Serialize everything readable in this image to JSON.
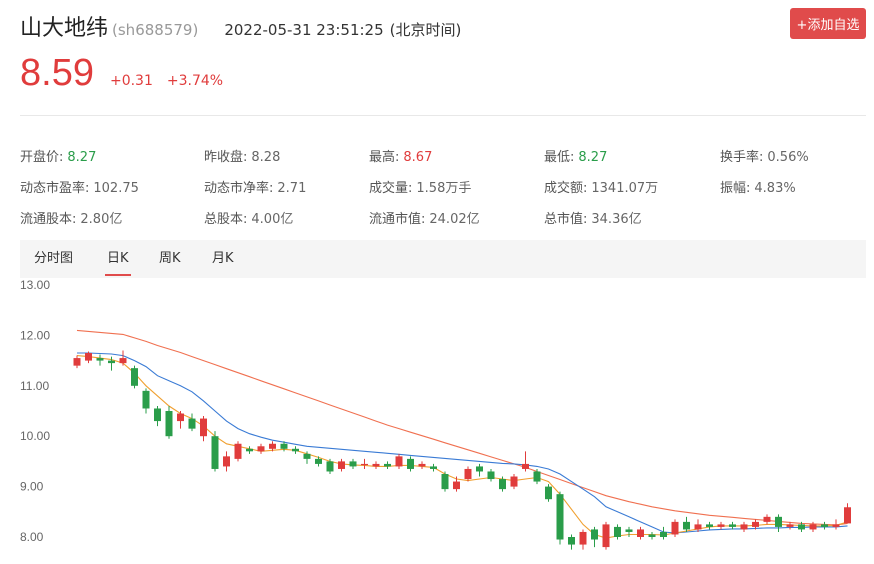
{
  "header": {
    "name": "山大地纬",
    "code": "(sh688579)",
    "datetime": "2022-05-31 23:51:25",
    "tz": "(北京时间)",
    "add_button": "+添加自选"
  },
  "quote": {
    "price": "8.59",
    "change": "+0.31",
    "change_pct": "+3.74%"
  },
  "stats": [
    {
      "label": "开盘价:",
      "value": "8.27",
      "tone": "green"
    },
    {
      "label": "昨收盘:",
      "value": "8.28",
      "tone": "gray"
    },
    {
      "label": "最高:",
      "value": "8.67",
      "tone": "red"
    },
    {
      "label": "最低:",
      "value": "8.27",
      "tone": "green"
    },
    {
      "label": "换手率:",
      "value": "0.56%",
      "tone": "gray"
    },
    {
      "label": "动态市盈率:",
      "value": "102.75",
      "tone": "gray"
    },
    {
      "label": "动态市净率:",
      "value": "2.71",
      "tone": "gray"
    },
    {
      "label": "成交量:",
      "value": "1.58万手",
      "tone": "gray"
    },
    {
      "label": "成交额:",
      "value": "1341.07万",
      "tone": "gray"
    },
    {
      "label": "振幅:",
      "value": "4.83%",
      "tone": "gray"
    },
    {
      "label": "流通股本:",
      "value": "2.80亿",
      "tone": "gray"
    },
    {
      "label": "总股本:",
      "value": "4.00亿",
      "tone": "gray"
    },
    {
      "label": "流通市值:",
      "value": "24.02亿",
      "tone": "gray"
    },
    {
      "label": "总市值:",
      "value": "34.36亿",
      "tone": "gray"
    }
  ],
  "tabs": [
    "分时图",
    "日K",
    "周K",
    "月K"
  ],
  "active_tab": 1,
  "colors": {
    "up": "#e03c3c",
    "down": "#2a9d4a",
    "ma_fast": "#f0a030",
    "ma_mid": "#3a7bd5",
    "ma_slow": "#f07050"
  },
  "chart_data": {
    "type": "candlestick",
    "ylim": [
      7.8,
      13.0
    ],
    "yticks": [
      "13.00",
      "12.00",
      "11.00",
      "10.00",
      "9.00",
      "8.00"
    ],
    "ytick_values": [
      13,
      12,
      11,
      10,
      9,
      8
    ],
    "candles": [
      [
        11.4,
        11.55,
        11.35,
        11.6
      ],
      [
        11.5,
        11.65,
        11.45,
        11.68
      ],
      [
        11.55,
        11.5,
        11.4,
        11.62
      ],
      [
        11.5,
        11.45,
        11.3,
        11.58
      ],
      [
        11.45,
        11.55,
        11.4,
        11.7
      ],
      [
        11.35,
        11.0,
        10.95,
        11.4
      ],
      [
        10.9,
        10.55,
        10.45,
        10.95
      ],
      [
        10.55,
        10.3,
        10.2,
        10.6
      ],
      [
        10.5,
        10.0,
        9.95,
        10.6
      ],
      [
        10.3,
        10.45,
        10.15,
        10.5
      ],
      [
        10.35,
        10.15,
        10.1,
        10.45
      ],
      [
        10.0,
        10.35,
        9.9,
        10.4
      ],
      [
        10.0,
        9.35,
        9.3,
        10.1
      ],
      [
        9.4,
        9.6,
        9.3,
        9.7
      ],
      [
        9.55,
        9.85,
        9.5,
        9.9
      ],
      [
        9.75,
        9.7,
        9.65,
        9.8
      ],
      [
        9.7,
        9.8,
        9.65,
        9.85
      ],
      [
        9.75,
        9.85,
        9.7,
        9.9
      ],
      [
        9.85,
        9.75,
        9.7,
        9.9
      ],
      [
        9.75,
        9.7,
        9.65,
        9.8
      ],
      [
        9.65,
        9.55,
        9.45,
        9.7
      ],
      [
        9.55,
        9.45,
        9.4,
        9.6
      ],
      [
        9.5,
        9.3,
        9.25,
        9.55
      ],
      [
        9.35,
        9.5,
        9.3,
        9.55
      ],
      [
        9.5,
        9.4,
        9.35,
        9.55
      ],
      [
        9.45,
        9.45,
        9.35,
        9.55
      ],
      [
        9.4,
        9.45,
        9.35,
        9.5
      ],
      [
        9.45,
        9.4,
        9.35,
        9.5
      ],
      [
        9.4,
        9.6,
        9.35,
        9.65
      ],
      [
        9.55,
        9.35,
        9.3,
        9.6
      ],
      [
        9.4,
        9.45,
        9.35,
        9.5
      ],
      [
        9.4,
        9.35,
        9.3,
        9.45
      ],
      [
        9.25,
        8.95,
        8.9,
        9.3
      ],
      [
        8.95,
        9.1,
        8.9,
        9.2
      ],
      [
        9.15,
        9.35,
        9.1,
        9.4
      ],
      [
        9.4,
        9.3,
        9.2,
        9.45
      ],
      [
        9.3,
        9.15,
        9.1,
        9.35
      ],
      [
        9.15,
        8.95,
        8.9,
        9.2
      ],
      [
        9.0,
        9.2,
        8.95,
        9.25
      ],
      [
        9.35,
        9.45,
        9.3,
        9.7
      ],
      [
        9.3,
        9.1,
        9.05,
        9.35
      ],
      [
        9.0,
        8.75,
        8.7,
        9.05
      ],
      [
        8.85,
        7.95,
        7.85,
        8.9
      ],
      [
        8.0,
        7.85,
        7.75,
        8.05
      ],
      [
        7.85,
        8.1,
        7.75,
        8.15
      ],
      [
        8.15,
        7.95,
        7.8,
        8.2
      ],
      [
        7.8,
        8.25,
        7.75,
        8.3
      ],
      [
        8.2,
        8.0,
        7.95,
        8.25
      ],
      [
        8.15,
        8.1,
        8.0,
        8.2
      ],
      [
        8.0,
        8.15,
        7.95,
        8.2
      ],
      [
        8.05,
        8.0,
        7.95,
        8.1
      ],
      [
        8.1,
        8.0,
        7.95,
        8.2
      ],
      [
        8.05,
        8.3,
        8.0,
        8.35
      ],
      [
        8.3,
        8.15,
        8.1,
        8.4
      ],
      [
        8.15,
        8.25,
        8.1,
        8.35
      ],
      [
        8.25,
        8.2,
        8.15,
        8.3
      ],
      [
        8.2,
        8.25,
        8.15,
        8.3
      ],
      [
        8.25,
        8.2,
        8.15,
        8.3
      ],
      [
        8.15,
        8.25,
        8.1,
        8.3
      ],
      [
        8.2,
        8.3,
        8.15,
        8.35
      ],
      [
        8.3,
        8.4,
        8.25,
        8.45
      ],
      [
        8.4,
        8.2,
        8.1,
        8.45
      ],
      [
        8.2,
        8.25,
        8.15,
        8.3
      ],
      [
        8.25,
        8.15,
        8.1,
        8.3
      ],
      [
        8.15,
        8.25,
        8.1,
        8.3
      ],
      [
        8.25,
        8.2,
        8.15,
        8.3
      ],
      [
        8.2,
        8.25,
        8.15,
        8.35
      ],
      [
        8.27,
        8.59,
        8.27,
        8.67
      ]
    ],
    "ma_fast": [
      11.6,
      11.58,
      11.55,
      11.52,
      11.45,
      11.25,
      11.0,
      10.8,
      10.6,
      10.45,
      10.35,
      10.2,
      10.0,
      9.85,
      9.8,
      9.75,
      9.7,
      9.72,
      9.74,
      9.72,
      9.65,
      9.58,
      9.5,
      9.45,
      9.43,
      9.42,
      9.4,
      9.4,
      9.42,
      9.42,
      9.4,
      9.38,
      9.25,
      9.15,
      9.12,
      9.15,
      9.18,
      9.15,
      9.12,
      9.15,
      9.18,
      9.1,
      8.85,
      8.55,
      8.25,
      8.05,
      7.98,
      8.02,
      8.05,
      8.05,
      8.05,
      8.04,
      8.08,
      8.12,
      8.16,
      8.2,
      8.22,
      8.22,
      8.22,
      8.23,
      8.25,
      8.25,
      8.24,
      8.23,
      8.22,
      8.22,
      8.23,
      8.3
    ],
    "ma_mid": [
      11.65,
      11.65,
      11.64,
      11.63,
      11.6,
      11.5,
      11.38,
      11.2,
      11.1,
      11.0,
      10.88,
      10.7,
      10.5,
      10.3,
      10.15,
      10.05,
      9.98,
      9.92,
      9.88,
      9.84,
      9.8,
      9.78,
      9.76,
      9.74,
      9.72,
      9.7,
      9.68,
      9.66,
      9.64,
      9.62,
      9.6,
      9.58,
      9.56,
      9.54,
      9.52,
      9.5,
      9.48,
      9.46,
      9.45,
      9.43,
      9.4,
      9.35,
      9.25,
      9.1,
      8.95,
      8.8,
      8.6,
      8.5,
      8.4,
      8.3,
      8.2,
      8.1,
      8.08,
      8.1,
      8.12,
      8.14,
      8.15,
      8.16,
      8.16,
      8.17,
      8.18,
      8.18,
      8.19,
      8.19,
      8.2,
      8.2,
      8.2,
      8.22
    ],
    "ma_slow": [
      12.1,
      12.08,
      12.06,
      12.04,
      12.02,
      11.95,
      11.88,
      11.8,
      11.73,
      11.66,
      11.58,
      11.5,
      11.42,
      11.34,
      11.26,
      11.18,
      11.1,
      11.02,
      10.94,
      10.86,
      10.78,
      10.7,
      10.62,
      10.54,
      10.46,
      10.38,
      10.3,
      10.22,
      10.15,
      10.08,
      10.01,
      9.94,
      9.87,
      9.8,
      9.73,
      9.66,
      9.59,
      9.52,
      9.45,
      9.38,
      9.3,
      9.22,
      9.14,
      9.06,
      8.98,
      8.9,
      8.82,
      8.76,
      8.7,
      8.65,
      8.6,
      8.56,
      8.52,
      8.49,
      8.46,
      8.43,
      8.41,
      8.39,
      8.37,
      8.35,
      8.33,
      8.31,
      8.29,
      8.27,
      8.26,
      8.25,
      8.24,
      8.27
    ]
  }
}
